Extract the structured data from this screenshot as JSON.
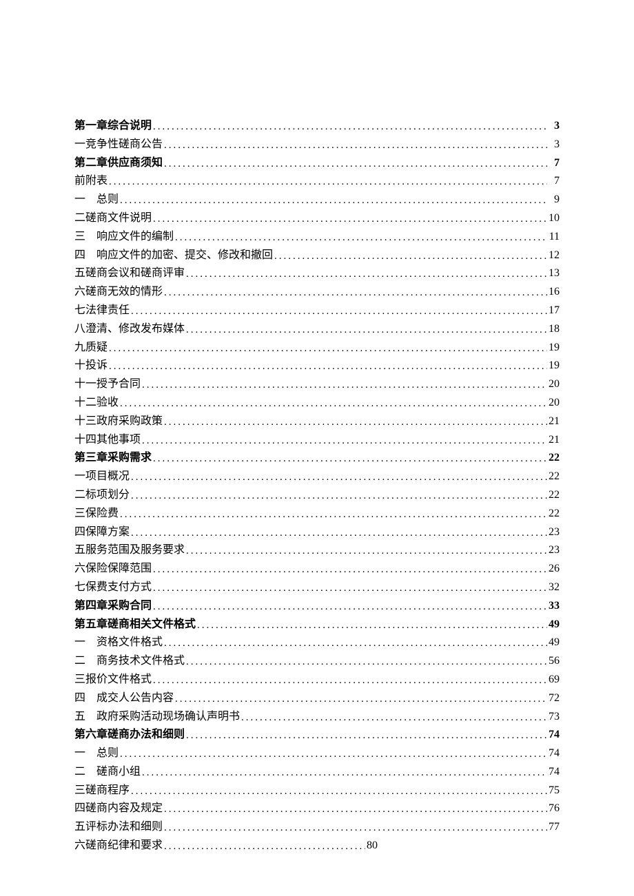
{
  "toc": [
    {
      "label": "第一章综合说明",
      "page": "3",
      "bold": true
    },
    {
      "label": "一竞争性磋商公告",
      "page": "3",
      "bold": false
    },
    {
      "label": "第二章供应商须知",
      "page": "7",
      "bold": true
    },
    {
      "label": "前附表",
      "page": "7",
      "bold": false
    },
    {
      "label": "一　总则",
      "page": "9",
      "bold": false
    },
    {
      "label": "二磋商文件说明",
      "page": "10",
      "bold": false
    },
    {
      "label": "三　响应文件的编制",
      "page": "11",
      "bold": false
    },
    {
      "label": "四　响应文件的加密、提交、修改和撤回",
      "page": "12",
      "bold": false
    },
    {
      "label": "五磋商会议和磋商评审",
      "page": "13",
      "bold": false
    },
    {
      "label": "六磋商无效的情形",
      "page": "16",
      "bold": false
    },
    {
      "label": "七法律责任",
      "page": "17",
      "bold": false
    },
    {
      "label": "八澄清、修改发布媒体",
      "page": "18",
      "bold": false
    },
    {
      "label": "九质疑",
      "page": "19",
      "bold": false
    },
    {
      "label": "十投诉",
      "page": "19",
      "bold": false
    },
    {
      "label": "十一授予合同",
      "page": "20",
      "bold": false
    },
    {
      "label": "十二验收",
      "page": "20",
      "bold": false
    },
    {
      "label": "十三政府采购政策",
      "page": "21",
      "bold": false
    },
    {
      "label": "十四其他事项",
      "page": "21",
      "bold": false
    },
    {
      "label": "第三章采购需求",
      "page": "22",
      "bold": true
    },
    {
      "label": "一项目概况",
      "page": "22",
      "bold": false
    },
    {
      "label": "二标项划分",
      "page": "22",
      "bold": false
    },
    {
      "label": "三保险费",
      "page": "22",
      "bold": false
    },
    {
      "label": "四保障方案",
      "page": "23",
      "bold": false
    },
    {
      "label": "五服务范围及服务要求",
      "page": "23",
      "bold": false
    },
    {
      "label": "六保险保障范围",
      "page": "26",
      "bold": false
    },
    {
      "label": "七保费支付方式",
      "page": "32",
      "bold": false
    },
    {
      "label": "第四章采购合同",
      "page": "33",
      "bold": true
    },
    {
      "label": "第五章磋商相关文件格式",
      "page": "49",
      "bold": true
    },
    {
      "label": "一　资格文件格式",
      "page": "49",
      "bold": false
    },
    {
      "label": "二　商务技术文件格式",
      "page": "56",
      "bold": false
    },
    {
      "label": "三报价文件格式",
      "page": "69",
      "bold": false
    },
    {
      "label": "四　成交人公告内容",
      "page": "72",
      "bold": false
    },
    {
      "label": "五　政府采购活动现场确认声明书",
      "page": "73",
      "bold": false
    },
    {
      "label": "第六章磋商办法和细则",
      "page": "74",
      "bold": true
    },
    {
      "label": "一　总则",
      "page": "74",
      "bold": false
    },
    {
      "label": "二　磋商小组",
      "page": "74",
      "bold": false
    },
    {
      "label": "三磋商程序",
      "page": "75",
      "bold": false
    },
    {
      "label": "四磋商内容及规定",
      "page": "76",
      "bold": false
    },
    {
      "label": "五评标办法和细则",
      "page": "77",
      "bold": false
    },
    {
      "label": "六磋商纪律和要求",
      "page": "80",
      "bold": false,
      "short": true
    }
  ]
}
